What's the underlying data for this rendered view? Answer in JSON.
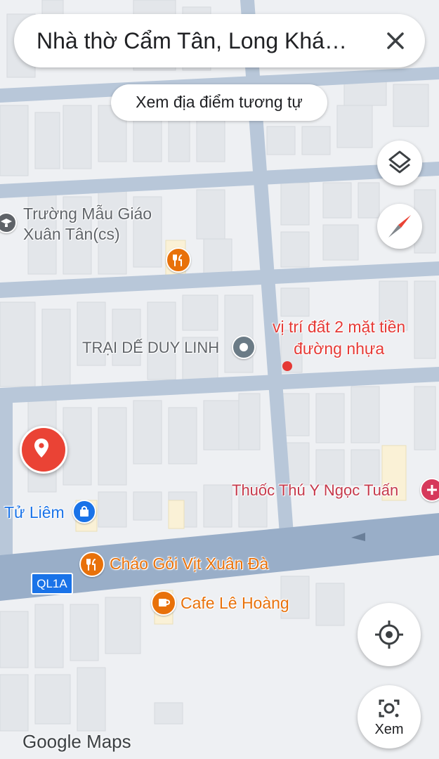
{
  "search": {
    "text": "Nhà thờ Cẩm Tân, Long Khá…"
  },
  "chip": {
    "label": "Xem địa điểm tương tự"
  },
  "places": {
    "school": "Trường Mẫu Giáo\nXuân Tân(cs)",
    "trai_de": "TRẠI DẾ DUY LINH",
    "annotation": "vị trí đất 2 mặt tiền\nđường nhựa",
    "thuoc_thu_y": "Thuốc Thú Y Ngọc Tuấn",
    "tu_liem": "Tử Liêm",
    "chao_goi": "Cháo Gỏi Vịt Xuân Đà",
    "cafe": "Cafe Lê Hoàng"
  },
  "road_shield": "QL1A",
  "lens_button": {
    "label": "Xem"
  },
  "logo": "Google Maps",
  "colors": {
    "pin_red": "#ea4335",
    "annotation_red": "#e53935",
    "food_orange": "#e8710a",
    "shop_blue": "#1a73e8",
    "place_gray": "#5f6368",
    "road_main": "#99aec8",
    "road_minor": "#b8c7d9"
  },
  "icons": {
    "close": "close-icon",
    "layers": "layers-icon",
    "compass": "compass-icon",
    "location": "my-location-icon",
    "lens": "lens-icon"
  }
}
